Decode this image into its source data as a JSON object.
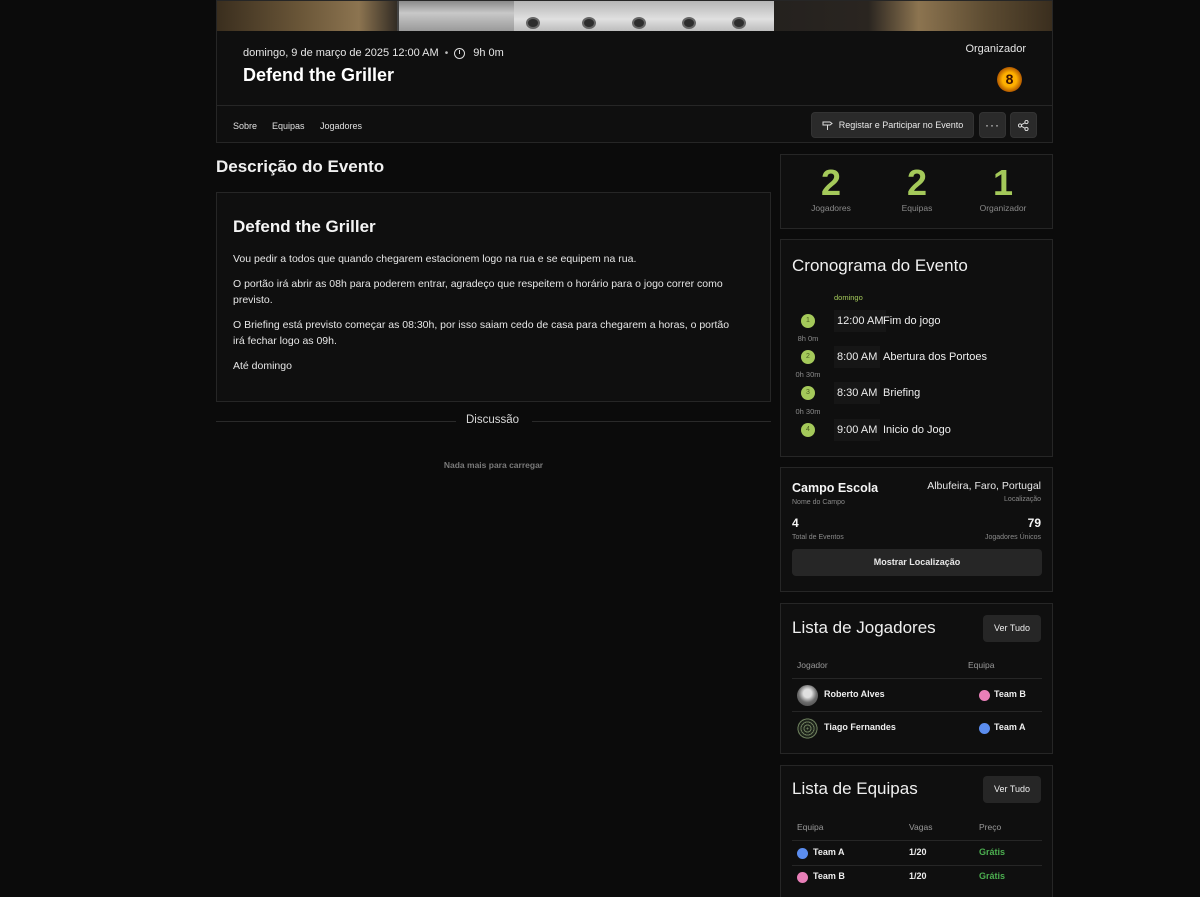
{
  "event": {
    "date": "domingo, 9 de março de 2025 12:00 AM",
    "separator": "•",
    "duration": "9h 0m",
    "title": "Defend the Griller",
    "organizer_label": "Organizador",
    "organizer_avatar_text": "8"
  },
  "tabs": [
    "Sobre",
    "Equipas",
    "Jogadores"
  ],
  "actions": {
    "register_label": "Registar e Participar no Evento",
    "more_label": "···"
  },
  "description": {
    "heading": "Descrição do Evento",
    "title": "Defend the Griller",
    "paragraphs": [
      "Vou pedir a todos que quando chegarem estacionem logo na rua e se equipem na rua.",
      "O portão irá abrir as 08h para poderem entrar, agradeço que respeitem o horário para o jogo correr como previsto.",
      "O Briefing está previsto começar as 08:30h, por isso saiam cedo de casa para chegarem a horas, o portão irá fechar logo as 09h.",
      "Até domingo"
    ]
  },
  "discussion": {
    "label": "Discussão",
    "empty_text": "Nada mais para carregar"
  },
  "stats": [
    {
      "value": "2",
      "label": "Jogadores"
    },
    {
      "value": "2",
      "label": "Equipas"
    },
    {
      "value": "1",
      "label": "Organizador"
    }
  ],
  "schedule": {
    "title": "Cronograma do Evento",
    "day": "domingo",
    "items": [
      {
        "num": "1",
        "time": "12:00 AM",
        "name": "Fim do jogo"
      },
      {
        "num": "2",
        "time": "8:00 AM",
        "name": "Abertura dos Portoes"
      },
      {
        "num": "3",
        "time": "8:30 AM",
        "name": "Briefing"
      },
      {
        "num": "4",
        "time": "9:00 AM",
        "name": "Inicio do Jogo"
      }
    ],
    "gaps": [
      "8h 0m",
      "0h 30m",
      "0h 30m"
    ]
  },
  "venue": {
    "name": "Campo Escola",
    "name_label": "Nome do Campo",
    "location": "Albufeira, Faro, Portugal",
    "location_label": "Localização",
    "total_events": "4",
    "total_events_label": "Total de Eventos",
    "unique_players": "79",
    "unique_players_label": "Jogadores Únicos",
    "show_location_label": "Mostrar Localização"
  },
  "players_list": {
    "title": "Lista de Jogadores",
    "view_all": "Ver Tudo",
    "col_player": "Jogador",
    "col_team": "Equipa",
    "rows": [
      {
        "name": "Roberto Alves",
        "team": "Team B",
        "team_color": "#e87fb8"
      },
      {
        "name": "Tiago Fernandes",
        "team": "Team A",
        "team_color": "#5b8def"
      }
    ]
  },
  "teams_list": {
    "title": "Lista de Equipas",
    "view_all": "Ver Tudo",
    "col_team": "Equipa",
    "col_slots": "Vagas",
    "col_price": "Preço",
    "rows": [
      {
        "name": "Team A",
        "slots": "1/20",
        "price": "Grátis",
        "color": "#5b8def"
      },
      {
        "name": "Team B",
        "slots": "1/20",
        "price": "Grátis",
        "color": "#e87fb8"
      }
    ]
  },
  "colors": {
    "accent": "#a4c95a",
    "free": "#4caf50",
    "team_a": "#5b8def",
    "team_b": "#e87fb8"
  }
}
